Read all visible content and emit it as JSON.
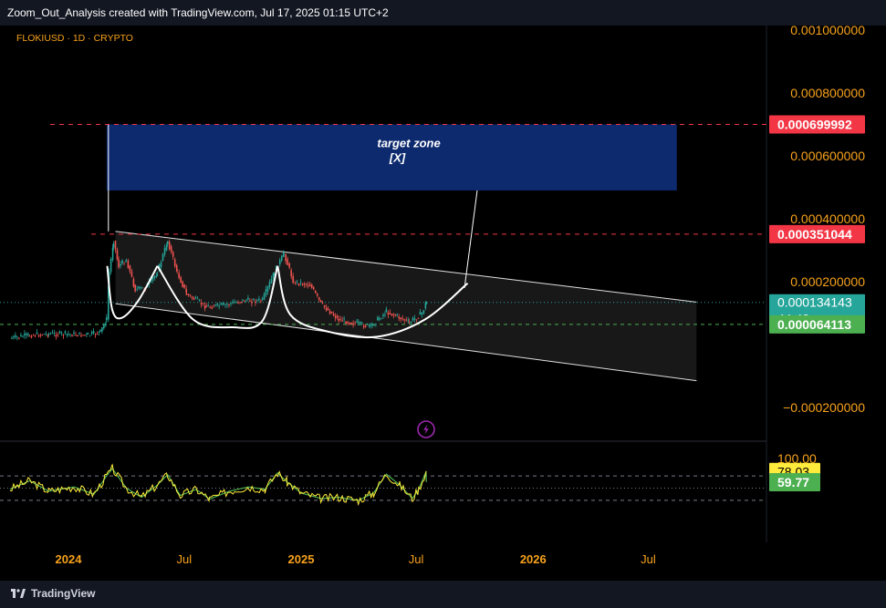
{
  "header": {
    "title": "Zoom_Out_Analysis created with TradingView.com, Jul 17, 2025 01:15 UTC+2"
  },
  "footer": {
    "brand": "TradingView"
  },
  "symbol": {
    "label": "FLOKIUSD · 1D · CRYPTO"
  },
  "colors": {
    "background": "#000000",
    "axis_text": "#f7a21b",
    "price_badge": "#f23645",
    "current_badge": "#26a69a",
    "support_badge": "#4caf50",
    "rsi_badge": "#ffeb3b",
    "target_zone": "#0d2a6e",
    "candle_up": "#26a69a",
    "candle_down": "#ef5350"
  },
  "chart_data": {
    "type": "candlestick",
    "price_axis": {
      "ticks": [
        "0.001000000",
        "0.000800000",
        "0.000600000",
        "0.000400000",
        "0.000200000",
        "−0.000200000"
      ],
      "tick_values": [
        0.001,
        0.0008,
        0.0006,
        0.0004,
        0.0002,
        -0.0002
      ]
    },
    "time_axis": {
      "ticks": [
        "2024",
        "Jul",
        "2025",
        "Jul",
        "2026",
        "Jul"
      ],
      "tick_dates": [
        "2024-01-01",
        "2024-07-01",
        "2025-01-01",
        "2025-07-01",
        "2026-01-01",
        "2026-07-01"
      ],
      "bold": [
        true,
        false,
        true,
        false,
        true,
        false
      ]
    },
    "levels": [
      {
        "label": "0.000699992",
        "value": 0.000699992,
        "style": "dashed",
        "badge": "red"
      },
      {
        "label": "0.000351044",
        "value": 0.000351044,
        "style": "dashed",
        "badge": "red"
      },
      {
        "label": "0.000134143",
        "value": 0.000134143,
        "style": "dotted",
        "badge": "teal"
      },
      {
        "label": "0.000064113",
        "value": 6.4113e-05,
        "style": "dashed",
        "badge": "green"
      }
    ],
    "countdown": "44:42",
    "target_zone": {
      "label_line1": "target zone",
      "label_line2": "[X]",
      "start": "2024-03-01",
      "end": "2026-08-15",
      "top": 0.000699992,
      "bottom": 0.00049
    },
    "channel": {
      "upper": [
        {
          "date": "2024-03-15",
          "value": 0.00036
        },
        {
          "date": "2026-09-15",
          "value": 0.000135
        }
      ],
      "lower": [
        {
          "date": "2024-03-15",
          "value": 0.00013
        },
        {
          "date": "2026-09-15",
          "value": -0.000115
        }
      ]
    },
    "price_series": [
      {
        "date": "2023-10-01",
        "value": 1.9e-05
      },
      {
        "date": "2023-11-01",
        "value": 3e-05
      },
      {
        "date": "2023-12-01",
        "value": 3.4e-05
      },
      {
        "date": "2024-01-01",
        "value": 3.3e-05
      },
      {
        "date": "2024-02-01",
        "value": 3e-05
      },
      {
        "date": "2024-02-20",
        "value": 4e-05
      },
      {
        "date": "2024-03-01",
        "value": 8e-05
      },
      {
        "date": "2024-03-05",
        "value": 0.00023
      },
      {
        "date": "2024-03-12",
        "value": 0.00033
      },
      {
        "date": "2024-03-20",
        "value": 0.00025
      },
      {
        "date": "2024-04-01",
        "value": 0.00027
      },
      {
        "date": "2024-04-15",
        "value": 0.000175
      },
      {
        "date": "2024-05-01",
        "value": 0.00018
      },
      {
        "date": "2024-05-20",
        "value": 0.00023
      },
      {
        "date": "2024-06-05",
        "value": 0.00033
      },
      {
        "date": "2024-06-20",
        "value": 0.00023
      },
      {
        "date": "2024-07-05",
        "value": 0.00016
      },
      {
        "date": "2024-08-05",
        "value": 0.00012
      },
      {
        "date": "2024-09-01",
        "value": 0.000125
      },
      {
        "date": "2024-10-01",
        "value": 0.00014
      },
      {
        "date": "2024-11-01",
        "value": 0.00014
      },
      {
        "date": "2024-11-20",
        "value": 0.00023
      },
      {
        "date": "2024-12-05",
        "value": 0.00029
      },
      {
        "date": "2024-12-20",
        "value": 0.0002
      },
      {
        "date": "2025-01-15",
        "value": 0.00019
      },
      {
        "date": "2025-02-01",
        "value": 0.00013
      },
      {
        "date": "2025-03-01",
        "value": 8e-05
      },
      {
        "date": "2025-04-01",
        "value": 6.5e-05
      },
      {
        "date": "2025-04-20",
        "value": 5.8e-05
      },
      {
        "date": "2025-05-15",
        "value": 0.000105
      },
      {
        "date": "2025-06-01",
        "value": 9e-05
      },
      {
        "date": "2025-06-20",
        "value": 7e-05
      },
      {
        "date": "2025-07-10",
        "value": 0.0001
      },
      {
        "date": "2025-07-17",
        "value": 0.000134
      }
    ],
    "cup_arcs": [
      [
        {
          "date": "2024-03-02",
          "value": 0.00025
        },
        {
          "date": "2024-03-10",
          "value": 0.00011
        },
        {
          "date": "2024-03-25",
          "value": 8.5e-05
        },
        {
          "date": "2024-04-20",
          "value": 0.00014
        },
        {
          "date": "2024-05-20",
          "value": 0.00025
        }
      ],
      [
        {
          "date": "2024-05-20",
          "value": 0.00025
        },
        {
          "date": "2024-07-15",
          "value": 8e-05
        },
        {
          "date": "2024-09-15",
          "value": 5.5e-05
        },
        {
          "date": "2024-11-01",
          "value": 7.5e-05
        },
        {
          "date": "2024-11-25",
          "value": 0.00025
        }
      ],
      [
        {
          "date": "2024-11-25",
          "value": 0.00025
        },
        {
          "date": "2024-12-15",
          "value": 9.5e-05
        },
        {
          "date": "2025-02-15",
          "value": 4e-05
        },
        {
          "date": "2025-05-01",
          "value": 2.5e-05
        },
        {
          "date": "2025-07-15",
          "value": 8e-05
        },
        {
          "date": "2025-09-20",
          "value": 0.000195
        }
      ]
    ],
    "projection_line": [
      {
        "date": "2025-09-15",
        "value": 0.00018
      },
      {
        "date": "2025-10-05",
        "value": 0.00049
      }
    ],
    "rsi": {
      "axis_label": "100.00",
      "value_label": "78.03",
      "ma_label": "59.77",
      "value": 78.03,
      "ma": 59.77,
      "bands": [
        70,
        50,
        30
      ],
      "series": [
        {
          "date": "2023-10-01",
          "value": 48
        },
        {
          "date": "2023-11-01",
          "value": 62
        },
        {
          "date": "2023-12-01",
          "value": 45
        },
        {
          "date": "2024-01-10",
          "value": 52
        },
        {
          "date": "2024-02-10",
          "value": 40
        },
        {
          "date": "2024-03-01",
          "value": 70
        },
        {
          "date": "2024-03-10",
          "value": 82
        },
        {
          "date": "2024-04-01",
          "value": 50
        },
        {
          "date": "2024-04-25",
          "value": 35
        },
        {
          "date": "2024-05-20",
          "value": 55
        },
        {
          "date": "2024-06-05",
          "value": 72
        },
        {
          "date": "2024-06-25",
          "value": 38
        },
        {
          "date": "2024-07-20",
          "value": 48
        },
        {
          "date": "2024-08-10",
          "value": 32
        },
        {
          "date": "2024-09-10",
          "value": 45
        },
        {
          "date": "2024-10-10",
          "value": 52
        },
        {
          "date": "2024-11-05",
          "value": 48
        },
        {
          "date": "2024-11-25",
          "value": 75
        },
        {
          "date": "2024-12-10",
          "value": 60
        },
        {
          "date": "2025-01-01",
          "value": 42
        },
        {
          "date": "2025-02-01",
          "value": 33
        },
        {
          "date": "2025-03-01",
          "value": 35
        },
        {
          "date": "2025-04-01",
          "value": 30
        },
        {
          "date": "2025-04-25",
          "value": 42
        },
        {
          "date": "2025-05-15",
          "value": 73
        },
        {
          "date": "2025-06-05",
          "value": 55
        },
        {
          "date": "2025-06-25",
          "value": 33
        },
        {
          "date": "2025-07-05",
          "value": 48
        },
        {
          "date": "2025-07-17",
          "value": 78
        }
      ]
    }
  }
}
